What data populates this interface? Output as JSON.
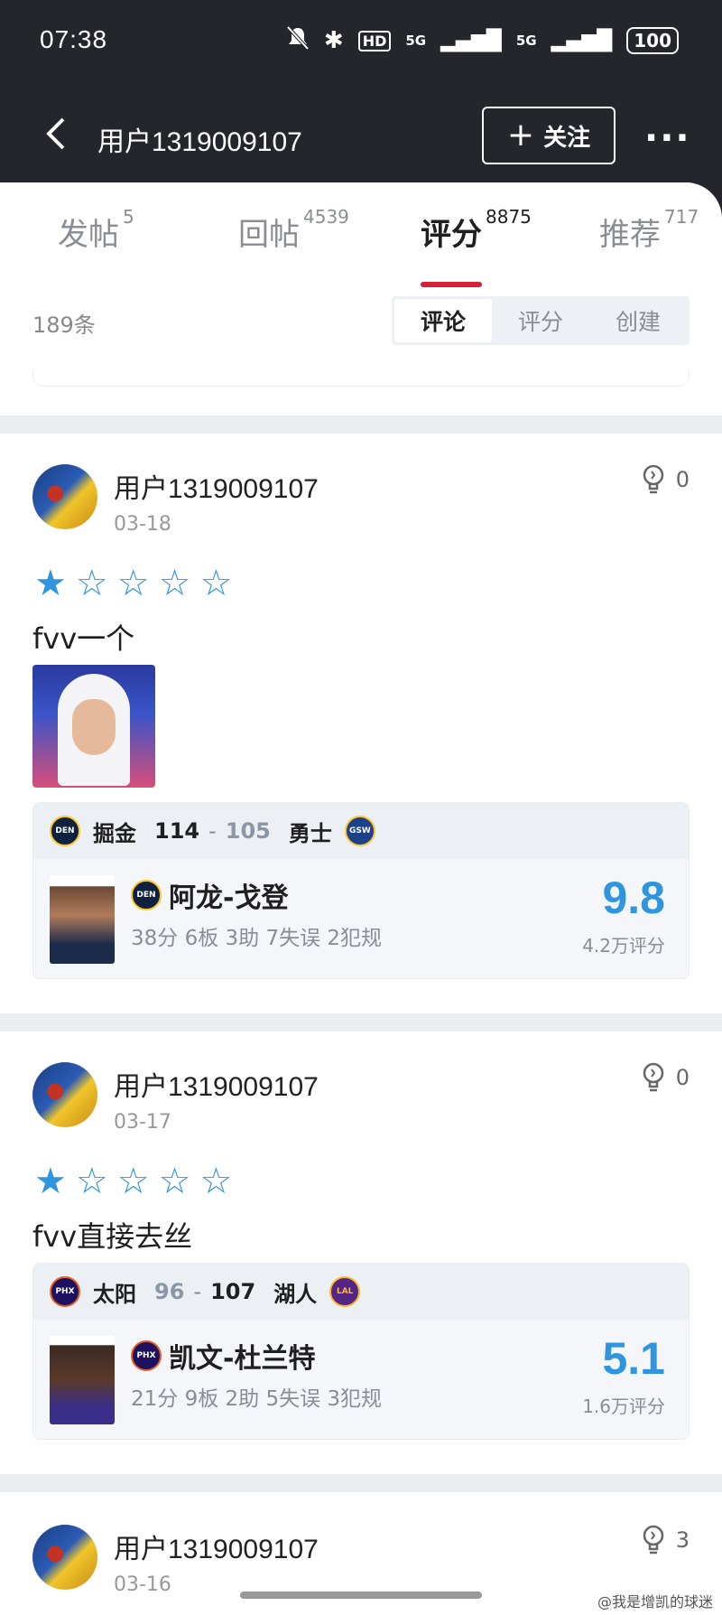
{
  "status_bar": {
    "time": "07:38",
    "hd": "HD",
    "net1": "5G",
    "net2": "5G",
    "battery": "100"
  },
  "nav": {
    "title": "用户1319009107",
    "follow_label": "关注"
  },
  "tabs": [
    {
      "label": "发帖",
      "count": "5"
    },
    {
      "label": "回帖",
      "count": "4539"
    },
    {
      "label": "评分",
      "count": "8875"
    },
    {
      "label": "推荐",
      "count": "717"
    }
  ],
  "list": {
    "count_label": "189条",
    "segments": [
      "评论",
      "评分",
      "创建"
    ]
  },
  "cards": [
    {
      "user": "用户1319009107",
      "date": "03-18",
      "likes": "0",
      "stars": 1,
      "text": "fvv一个",
      "game": {
        "home": "掘金",
        "home_score": "114",
        "away_score": "105",
        "away": "勇士",
        "home_logo": "DEN",
        "away_logo": "GSW"
      },
      "player": {
        "name": "阿龙-戈登",
        "team_logo": "DEN",
        "stats": "38分 6板 3助 7失误 2犯规",
        "rating": "9.8",
        "rating_count": "4.2万评分"
      }
    },
    {
      "user": "用户1319009107",
      "date": "03-17",
      "likes": "0",
      "stars": 1,
      "text": "fvv直接去丝",
      "game": {
        "home": "太阳",
        "home_score": "96",
        "away_score": "107",
        "away": "湖人",
        "home_logo": "PHX",
        "away_logo": "LAL"
      },
      "player": {
        "name": "凯文-杜兰特",
        "team_logo": "PHX",
        "stats": "21分 9板 2助 5失误 3犯规",
        "rating": "5.1",
        "rating_count": "1.6万评分"
      }
    },
    {
      "user": "用户1319009107",
      "date": "03-16",
      "likes": "3"
    }
  ],
  "watermark": "@我是增凯的球迷",
  "colors": {
    "accent": "#2f95de",
    "tab_underline": "#d6203a",
    "header_bg": "#24262b"
  }
}
